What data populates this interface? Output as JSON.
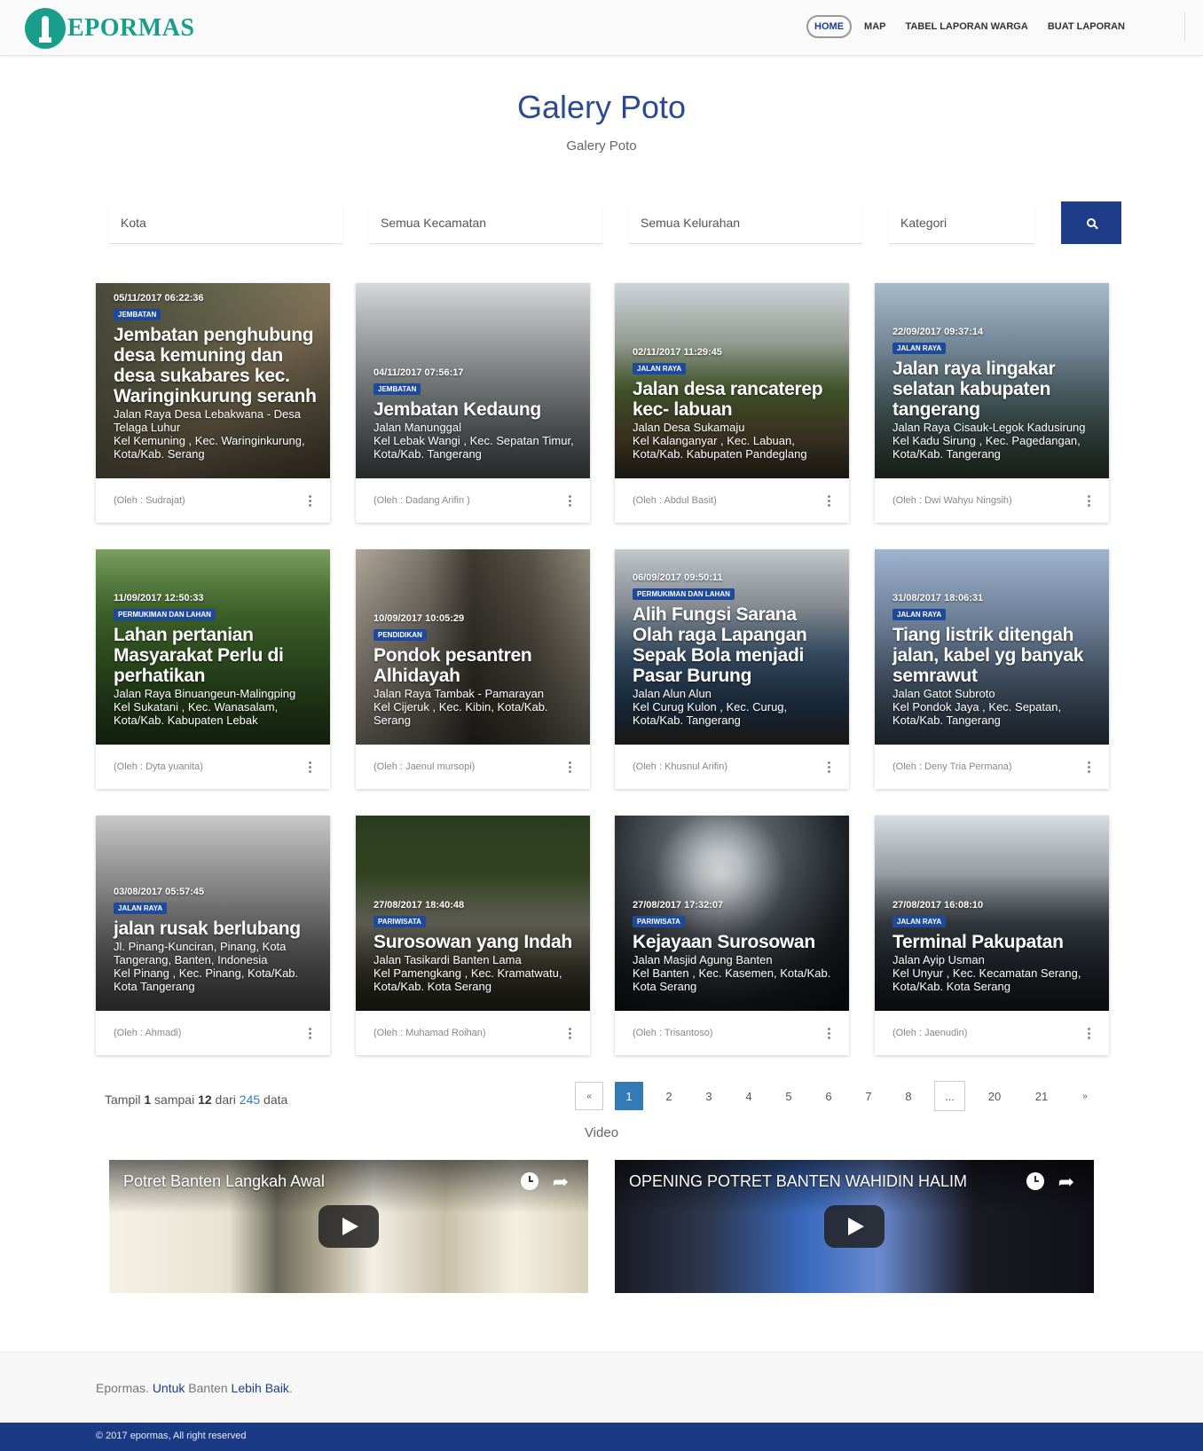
{
  "header": {
    "logo_text": "EPORMAS",
    "nav": [
      "HOME",
      "MAP",
      "TABEL LAPORAN WARGA",
      "BUAT LAPORAN"
    ]
  },
  "page": {
    "title": "Galery Poto",
    "subtitle": "Galery Poto"
  },
  "filters": {
    "kota": "Kota",
    "kecamatan": "Semua Kecamatan",
    "kelurahan": "Semua Kelurahan",
    "kategori": "Kategori",
    "search_icon": "search-icon"
  },
  "cards": [
    {
      "date": "05/11/2017 06:22:36",
      "category": "JEMBATAN",
      "title": "Jembatan penghubung desa kemuning dan desa sukabares kec. Waringinkurung seranh",
      "address": "Jalan Raya Desa Lebakwana - Desa Telaga Luhur",
      "location": "Kel Kemuning , Kec. Waringinkurung, Kota/Kab. Serang",
      "author": "(Oleh : Sudrajat)"
    },
    {
      "date": "04/11/2017 07:56:17",
      "category": "JEMBATAN",
      "title": "Jembatan Kedaung",
      "address": "Jalan Manunggal",
      "location": "Kel Lebak Wangi , Kec. Sepatan Timur, Kota/Kab. Tangerang",
      "author": "(Oleh : Dadang Arifin )"
    },
    {
      "date": "02/11/2017 11:29:45",
      "category": "JALAN RAYA",
      "title": "Jalan desa rancaterep kec- labuan",
      "address": "Jalan Desa Sukamaju",
      "location": "Kel Kalanganyar , Kec. Labuan, Kota/Kab. Kabupaten Pandeglang",
      "author": "(Oleh : Abdul Basit)"
    },
    {
      "date": "22/09/2017 09:37:14",
      "category": "JALAN RAYA",
      "title": "Jalan raya lingakar selatan kabupaten tangerang",
      "address": "Jalan Raya Cisauk-Legok Kadusirung",
      "location": "Kel Kadu Sirung , Kec. Pagedangan, Kota/Kab. Tangerang",
      "author": "(Oleh : Dwi Wahyu Ningsih)"
    },
    {
      "date": "11/09/2017 12:50:33",
      "category": "PERMUKIMAN DAN LAHAN",
      "title": "Lahan pertanian Masyarakat Perlu di perhatikan",
      "address": "Jalan Raya Binuangeun-Malingping",
      "location": "Kel Sukatani , Kec. Wanasalam, Kota/Kab. Kabupaten Lebak",
      "author": "(Oleh : Dyta yuanita)"
    },
    {
      "date": "10/09/2017 10:05:29",
      "category": "PENDIDIKAN",
      "title": "Pondok pesantren Alhidayah",
      "address": "Jalan Raya Tambak - Pamarayan",
      "location": "Kel Cijeruk , Kec. Kibin, Kota/Kab. Serang",
      "author": "(Oleh : Jaenul mursopi)"
    },
    {
      "date": "06/09/2017 09:50:11",
      "category": "PERMUKIMAN DAN LAHAN",
      "title": "Alih Fungsi Sarana Olah raga Lapangan Sepak Bola menjadi Pasar Burung",
      "address": "Jalan Alun Alun",
      "location": "Kel Curug Kulon , Kec. Curug, Kota/Kab. Tangerang",
      "author": "(Oleh : Khusnul Arifin)"
    },
    {
      "date": "31/08/2017 18:06:31",
      "category": "JALAN RAYA",
      "title": "Tiang listrik ditengah jalan, kabel yg banyak semrawut",
      "address": "Jalan Gatot Subroto",
      "location": "Kel Pondok Jaya , Kec. Sepatan, Kota/Kab. Tangerang",
      "author": "(Oleh : Deny Tria Permana)"
    },
    {
      "date": "03/08/2017 05:57:45",
      "category": "JALAN RAYA",
      "title": "jalan rusak berlubang",
      "address": "Jl. Pinang-Kunciran, Pinang, Kota Tangerang, Banten, Indonesia",
      "location": "Kel Pinang , Kec. Pinang, Kota/Kab. Kota Tangerang",
      "author": "(Oleh : Ahmadi)"
    },
    {
      "date": "27/08/2017 18:40:48",
      "category": "PARIWISATA",
      "title": "Surosowan yang Indah",
      "address": "Jalan Tasikardi Banten Lama",
      "location": "Kel Pamengkang , Kec. Kramatwatu, Kota/Kab. Kota Serang",
      "author": "(Oleh : Muhamad Roihan)"
    },
    {
      "date": "27/08/2017 17:32:07",
      "category": "PARIWISATA",
      "title": "Kejayaan Surosowan",
      "address": "Jalan Masjid Agung Banten",
      "location": "Kel Banten , Kec. Kasemen, Kota/Kab. Kota Serang",
      "author": "(Oleh : Trisantoso)"
    },
    {
      "date": "27/08/2017 16:08:10",
      "category": "JALAN RAYA",
      "title": "Terminal Pakupatan",
      "address": "Jalan Ayip Usman",
      "location": "Kel Unyur , Kec. Kecamatan Serang, Kota/Kab. Kota Serang",
      "author": "(Oleh : Jaenudin)"
    }
  ],
  "pagination": {
    "info_prefix": "Tampil",
    "from": "1",
    "to_label": "sampai",
    "to": "12",
    "of_label": "dari",
    "total": "245",
    "suffix": "data",
    "prev": "«",
    "pages": [
      "1",
      "2",
      "3",
      "4",
      "5",
      "6",
      "7",
      "8",
      "...",
      "20",
      "21"
    ],
    "next": "»",
    "current": "1"
  },
  "videos": {
    "section_title": "Video",
    "items": [
      {
        "title": "Potret Banten Langkah Awal"
      },
      {
        "title": "OPENING POTRET BANTEN WAHIDIN HALIM"
      }
    ]
  },
  "footer": {
    "brand": "Epormas.",
    "w1": "Untuk",
    "w2": "Banten",
    "w3": "Lebih Baik",
    "dot": ".",
    "copyright": "© 2017 epormas, All right reserved"
  }
}
